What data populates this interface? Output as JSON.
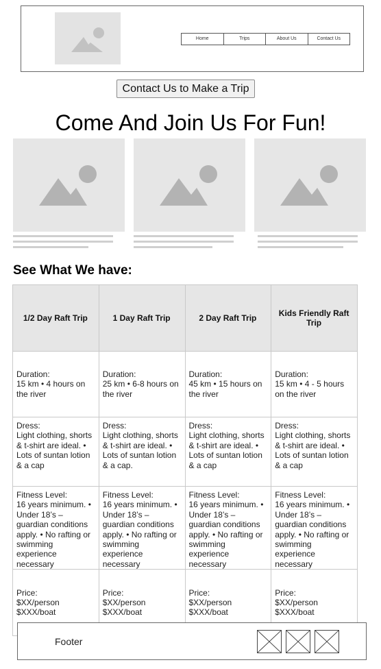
{
  "nav": {
    "items": [
      "Home",
      "Trips",
      "About Us",
      "Contact Us"
    ]
  },
  "cta": {
    "label": "Contact Us to Make a Trip"
  },
  "hero": {
    "title": "Come And Join Us For Fun!"
  },
  "section": {
    "title": "See What We have:"
  },
  "trips": [
    {
      "name": "1/2 Day Raft Trip",
      "duration": "Duration:\n15 km • 4 hours on the river",
      "dress": "Dress:\nLight clothing, shorts & t-shirt are ideal. • Lots of suntan lotion & a cap",
      "fitness": "Fitness Level:\n16 years minimum. • Under 18’s – guardian conditions apply. • No rafting or swimming experience necessary",
      "price": "Price:\n$XX/person\n$XXX/boat"
    },
    {
      "name": "1 Day Raft Trip",
      "duration": "Duration:\n25 km • 6-8 hours on the river",
      "dress": "Dress:\nLight clothing, shorts & t-shirt are ideal. • Lots of suntan lotion & a cap.",
      "fitness": "Fitness Level:\n16 years minimum. • Under 18’s – guardian conditions apply. • No rafting or swimming experience necessary",
      "price": "Price:\n$XX/person\n$XXX/boat"
    },
    {
      "name": "2 Day Raft Trip",
      "duration": "Duration:\n45 km • 15 hours on the river",
      "dress": "Dress:\nLight clothing, shorts & t-shirt are ideal. • Lots of suntan lotion & a cap",
      "fitness": "Fitness Level:\n16 years minimum. • Under 18’s – guardian conditions apply. • No rafting or swimming experience necessary",
      "price": "Price:\n$XX/person\n$XXX/boat"
    },
    {
      "name": "Kids Friendly Raft Trip",
      "duration": "Duration:\n15 km • 4 - 5 hours on the river",
      "dress": "Dress:\nLight clothing, shorts & t-shirt are ideal. • Lots of suntan lotion & a cap",
      "fitness": "Fitness Level:\n16 years minimum. • Under 18’s – guardian conditions apply. • No rafting or swimming experience necessary",
      "price": "Price:\n$XX/person\n$XXX/boat"
    }
  ],
  "footer": {
    "label": "Footer"
  },
  "icons": {
    "image_placeholder": "image-placeholder-icon",
    "social_placeholder": "image-missing-icon"
  },
  "colors": {
    "placeholder_bg": "#e6e6e6",
    "placeholder_fg": "#b3b3b3"
  }
}
